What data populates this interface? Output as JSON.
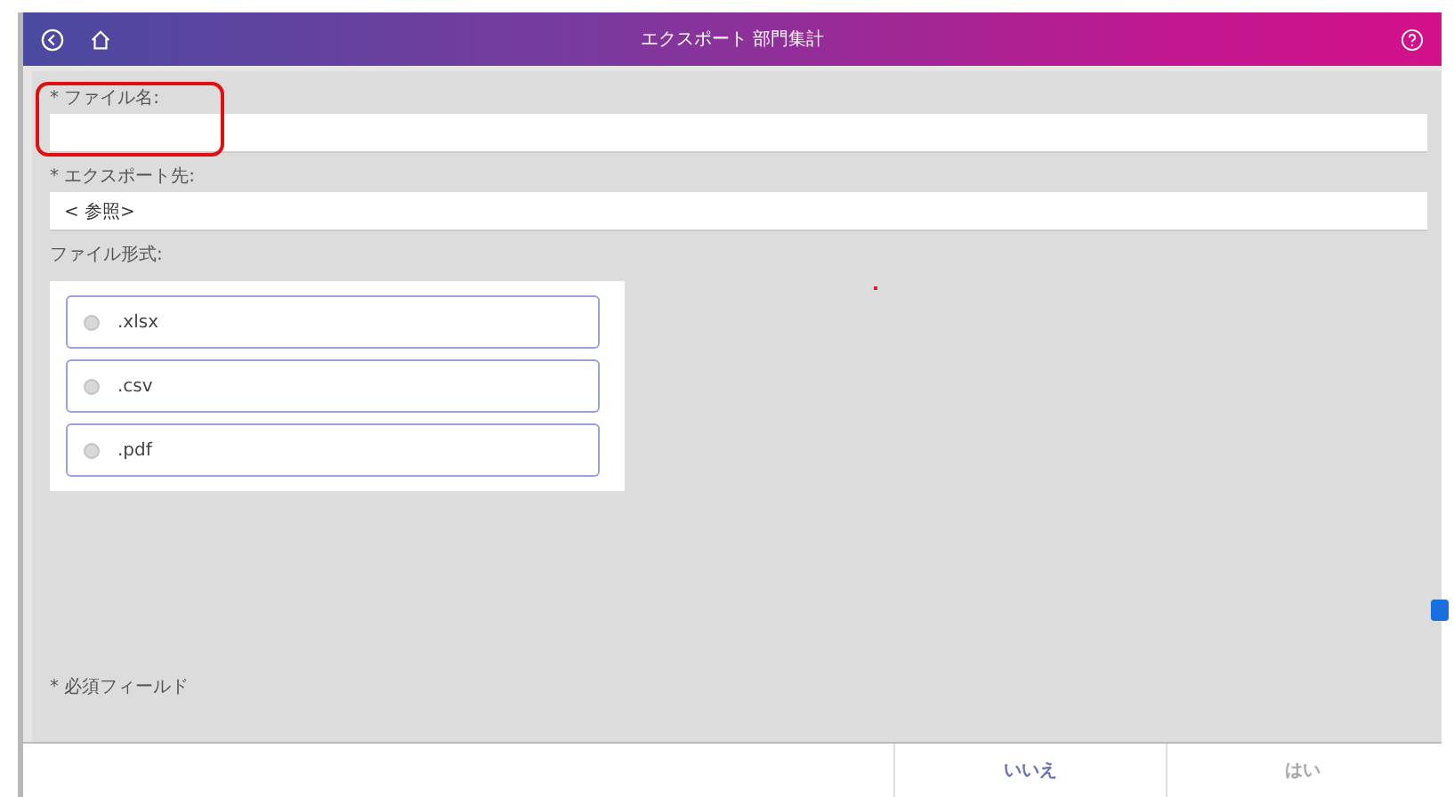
{
  "header": {
    "title": "エクスポート 部門集計"
  },
  "fields": [
    {
      "label": "* ファイル名:",
      "highlighted": true
    },
    {
      "label": "* エクスポート先:",
      "value": "< 参照>",
      "highlighted": false
    }
  ],
  "format": {
    "label": "ファイル形式:",
    "options": [
      {
        "label": ".xlsx",
        "selected": false
      },
      {
        "label": ".csv",
        "selected": false
      },
      {
        "label": ".pdf",
        "selected": false
      }
    ]
  },
  "required_note": "* 必須フィールド",
  "buttons": [
    {
      "label": "いいえ",
      "disabled": false
    },
    {
      "label": "はい",
      "disabled": true
    }
  ]
}
